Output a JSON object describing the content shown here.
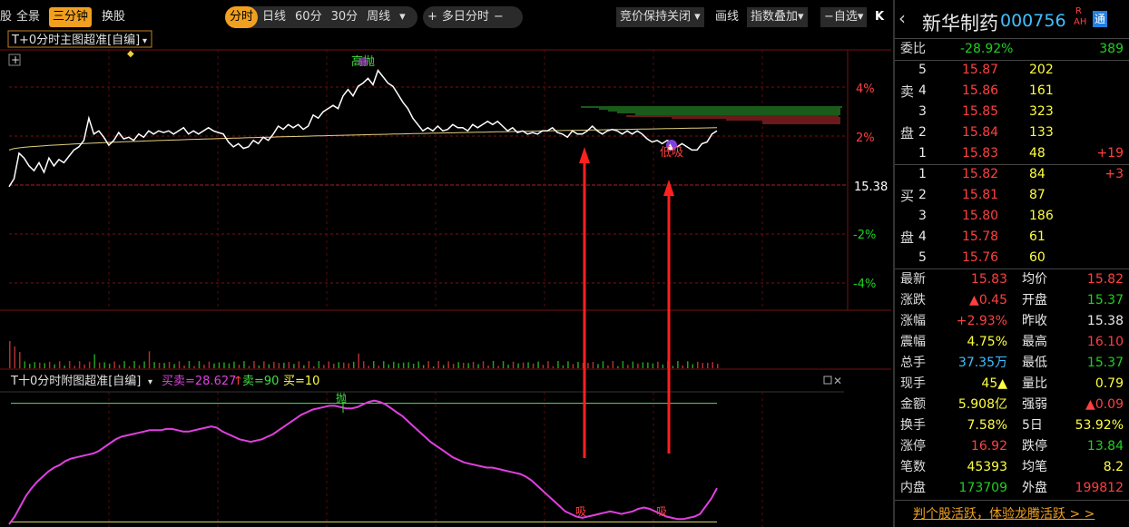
{
  "toolbar": {
    "left_cut": "股",
    "tab_all": "全景",
    "tab_three_min": "三分钟",
    "tab_switch": "换股",
    "periods": [
      "分时",
      "日线",
      "60分",
      "30分",
      "周线"
    ],
    "multi_day": "多日分时",
    "auction": "竞价保持关闭",
    "draw": "画线",
    "index_overlay": "指数叠加",
    "self_select": "自选",
    "panel_toggle": "K"
  },
  "main_chart": {
    "indicator_title": "T+0分时主图超准[自编]",
    "plus_icon": "+",
    "high_sell_label": "高抛",
    "low_buy_label": "低吸",
    "pct_labels": [
      "4%",
      "2%",
      "-2%",
      "-4%"
    ],
    "prev_close_label": "15.38",
    "price_series": [
      15.37,
      15.42,
      15.58,
      15.55,
      15.5,
      15.47,
      15.52,
      15.46,
      15.55,
      15.5,
      15.54,
      15.52,
      15.56,
      15.6,
      15.62,
      15.66,
      15.8,
      15.7,
      15.72,
      15.68,
      15.63,
      15.66,
      15.71,
      15.67,
      15.68,
      15.66,
      15.7,
      15.68,
      15.72,
      15.7,
      15.72,
      15.71,
      15.72,
      15.7,
      15.72,
      15.74,
      15.7,
      15.72,
      15.7,
      15.72,
      15.74,
      15.72,
      15.71,
      15.7,
      15.65,
      15.62,
      15.64,
      15.61,
      15.62,
      15.66,
      15.64,
      15.68,
      15.66,
      15.7,
      15.75,
      15.73,
      15.76,
      15.74,
      15.76,
      15.73,
      15.75,
      15.82,
      15.8,
      15.84,
      15.86,
      15.88,
      15.86,
      15.94,
      15.98,
      15.94,
      16.0,
      16.02,
      16.05,
      16.01,
      16.1,
      16.06,
      16.02,
      16.0,
      15.95,
      15.9,
      15.86,
      15.8,
      15.76,
      15.72,
      15.74,
      15.72,
      15.75,
      15.72,
      15.73,
      15.76,
      15.74,
      15.74,
      15.72,
      15.76,
      15.74,
      15.76,
      15.78,
      15.76,
      15.78,
      15.75,
      15.72,
      15.74,
      15.71,
      15.72,
      15.7,
      15.71,
      15.7,
      15.72,
      15.72,
      15.74,
      15.71,
      15.7,
      15.68,
      15.72,
      15.7,
      15.7,
      15.72,
      15.75,
      15.72,
      15.7,
      15.72,
      15.73,
      15.72,
      15.7,
      15.72,
      15.7,
      15.72,
      15.7,
      15.67,
      15.65,
      15.66,
      15.64,
      15.66,
      15.65,
      15.62,
      15.64,
      15.62,
      15.6,
      15.6,
      15.64,
      15.65,
      15.7,
      15.72
    ],
    "avg_series_start": 15.6,
    "avg_series_end": 15.74
  },
  "sub_chart": {
    "title": "T十0分时附图超准[自编]",
    "buy_sell_text": "买卖=28.627",
    "sell_text": "卖=90",
    "buy_text": "买=10",
    "sell_mark": "抛",
    "buy_mark": "吸",
    "upper_line": 90,
    "lower_line": 10,
    "series": [
      0,
      6,
      14,
      22,
      28,
      33,
      37,
      41,
      44,
      46,
      49,
      51,
      52,
      53,
      54,
      55,
      57,
      60,
      63,
      66,
      68,
      69,
      70,
      71,
      72,
      73,
      73,
      73,
      74,
      74,
      73,
      72,
      72,
      73,
      74,
      75,
      76,
      75,
      72,
      70,
      68,
      66,
      65,
      64,
      65,
      66,
      68,
      70,
      73,
      76,
      79,
      82,
      85,
      87,
      89,
      90,
      91,
      92,
      92,
      91,
      90,
      90,
      91,
      93,
      95,
      96,
      95,
      93,
      90,
      87,
      84,
      80,
      76,
      72,
      68,
      64,
      61,
      58,
      55,
      52,
      50,
      48,
      47,
      46,
      45,
      44,
      44,
      43,
      42,
      41,
      40,
      39,
      37,
      34,
      30,
      26,
      22,
      18,
      14,
      10,
      8,
      6,
      5,
      6,
      7,
      8,
      9,
      10,
      9,
      8,
      9,
      10,
      12,
      13,
      12,
      10,
      8,
      6,
      5,
      4,
      4,
      5,
      6,
      8,
      14,
      20,
      28
    ]
  },
  "stock": {
    "name": "新华制药",
    "code": "000756",
    "badge_r": "R",
    "badge_ah": "AH",
    "badge_tong": "通",
    "weibi_label": "委比",
    "weibi_value": "-28.92%",
    "weicha_value": "389",
    "sell_side_label": [
      "卖",
      "盘"
    ],
    "buy_side_label": [
      "买",
      "盘"
    ],
    "asks": [
      {
        "level": "5",
        "price": "15.87",
        "vol": "202",
        "chg": ""
      },
      {
        "level": "4",
        "price": "15.86",
        "vol": "161",
        "chg": ""
      },
      {
        "level": "3",
        "price": "15.85",
        "vol": "323",
        "chg": ""
      },
      {
        "level": "2",
        "price": "15.84",
        "vol": "133",
        "chg": ""
      },
      {
        "level": "1",
        "price": "15.83",
        "vol": "48",
        "chg": "+19"
      }
    ],
    "bids": [
      {
        "level": "1",
        "price": "15.82",
        "vol": "84",
        "chg": "+3"
      },
      {
        "level": "2",
        "price": "15.81",
        "vol": "87",
        "chg": ""
      },
      {
        "level": "3",
        "price": "15.80",
        "vol": "186",
        "chg": ""
      },
      {
        "level": "4",
        "price": "15.78",
        "vol": "61",
        "chg": ""
      },
      {
        "level": "5",
        "price": "15.76",
        "vol": "60",
        "chg": ""
      }
    ],
    "quotes": [
      {
        "l1": "最新",
        "v1": "15.83",
        "c1": "red",
        "l2": "均价",
        "v2": "15.82",
        "c2": "red"
      },
      {
        "l1": "涨跌",
        "v1": "▲0.45",
        "c1": "red",
        "l2": "开盘",
        "v2": "15.37",
        "c2": "green"
      },
      {
        "l1": "涨幅",
        "v1": "+2.93%",
        "c1": "red",
        "l2": "昨收",
        "v2": "15.38",
        "c2": "white"
      },
      {
        "l1": "震幅",
        "v1": "4.75%",
        "c1": "yellow",
        "l2": "最高",
        "v2": "16.10",
        "c2": "red"
      },
      {
        "l1": "总手",
        "v1": "37.35万",
        "c1": "cyan",
        "l2": "最低",
        "v2": "15.37",
        "c2": "green"
      },
      {
        "l1": "现手",
        "v1": "45▲",
        "c1": "yellow",
        "l2": "量比",
        "v2": "0.79",
        "c2": "yellow"
      },
      {
        "l1": "金额",
        "v1": "5.908亿",
        "c1": "yellow",
        "l2": "强弱",
        "v2": "▲0.09",
        "c2": "red"
      },
      {
        "l1": "换手",
        "v1": "7.58%",
        "c1": "yellow",
        "l2": "5日",
        "v2": "53.92%",
        "c2": "yellow"
      },
      {
        "l1": "涨停",
        "v1": "16.92",
        "c1": "red",
        "l2": "跌停",
        "v2": "13.84",
        "c2": "green"
      },
      {
        "l1": "笔数",
        "v1": "45393",
        "c1": "yellow",
        "l2": "均笔",
        "v2": "8.2",
        "c2": "yellow"
      },
      {
        "l1": "内盘",
        "v1": "173709",
        "c1": "green",
        "l2": "外盘",
        "v2": "199812",
        "c2": "red"
      }
    ],
    "promo": "判个股活跃，体验龙腾活跃 > >"
  },
  "colors": {
    "accent": "#f0a020",
    "up": "#ff4040",
    "down": "#20d020",
    "price_line": "#ffffff",
    "avg_line": "#e0d080",
    "indicator_line": "#e040e0",
    "grid_red": "#7a1010",
    "arrow": "#ff2020"
  }
}
